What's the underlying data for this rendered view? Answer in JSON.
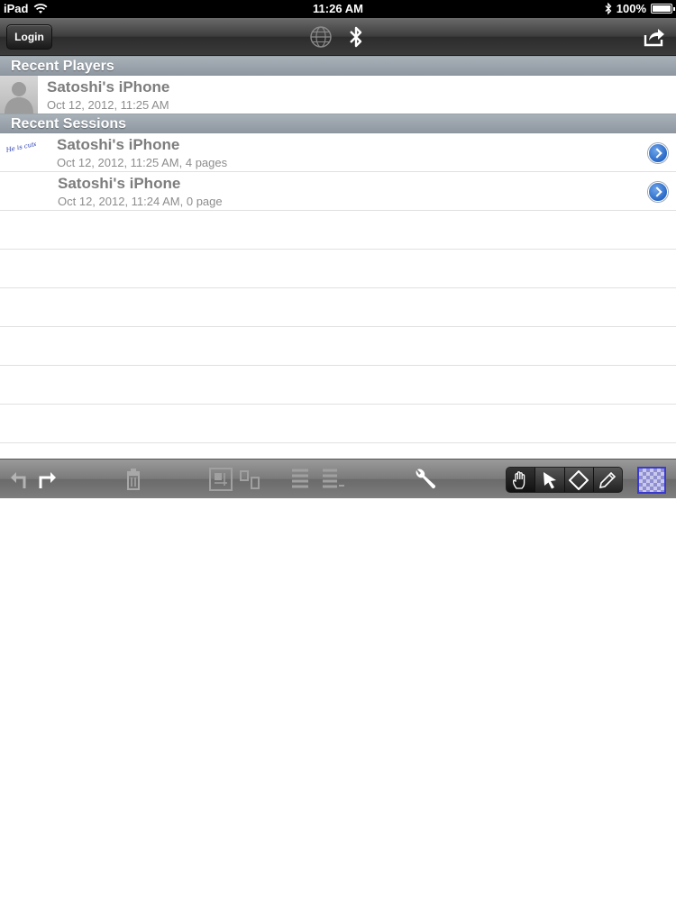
{
  "status_bar": {
    "device": "iPad",
    "time": "11:26 AM",
    "battery": "100%"
  },
  "nav_bar": {
    "login_label": "Login",
    "icons": [
      "globe-icon",
      "bluetooth-icon",
      "share-icon"
    ]
  },
  "recent_players": {
    "header": "Recent Players",
    "items": [
      {
        "name": "Satoshi's iPhone",
        "timestamp": "Oct 12, 2012, 11:25 AM"
      }
    ]
  },
  "recent_sessions": {
    "header": "Recent Sessions",
    "items": [
      {
        "name": "Satoshi's iPhone",
        "detail": "Oct 12, 2012, 11:25 AM, 4 pages",
        "thumbnail_text": "He is cute!"
      },
      {
        "name": "Satoshi's iPhone",
        "detail": "Oct 12, 2012, 11:24 AM, 0 page"
      }
    ]
  },
  "toolbar": {
    "icons": [
      "undo-icon",
      "redo-icon",
      "trash-icon",
      "page-layout-icon",
      "page-move-icon",
      "list-icon",
      "list-add-icon",
      "wrench-icon",
      "hand-tool-icon",
      "pointer-tool-icon",
      "eraser-tool-icon",
      "pencil-tool-icon",
      "color-swatch"
    ],
    "active_tool": "hand",
    "accent_color": "#3a3ad0"
  }
}
